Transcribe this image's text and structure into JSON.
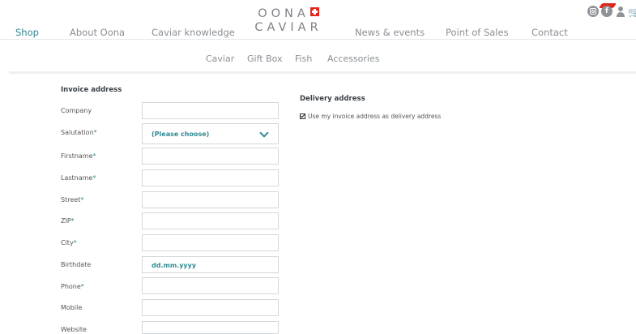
{
  "brand": {
    "logo_line1": "OONA",
    "logo_line2": "CAVIAR"
  },
  "nav": {
    "left": [
      {
        "label": "Shop",
        "active": true
      },
      {
        "label": "About Oona"
      },
      {
        "label": "Caviar knowledge"
      }
    ],
    "right": [
      {
        "label": "News & events"
      },
      {
        "label": "Point of Sales"
      },
      {
        "label": "Contact"
      }
    ]
  },
  "header_icons": [
    "instagram-icon",
    "facebook-icon",
    "user-icon",
    "cart-icon"
  ],
  "subnav": [
    {
      "label": "Caviar"
    },
    {
      "label": "Gift Box"
    },
    {
      "label": "Fish"
    },
    {
      "label": "Accessories"
    }
  ],
  "invoice": {
    "title": "Invoice address",
    "required_marker": "*",
    "fields": [
      {
        "label": "Company",
        "required": false,
        "value": ""
      },
      {
        "label": "Salutation",
        "required": true,
        "value": "(Please choose)",
        "type": "select"
      },
      {
        "label": "Firstname",
        "required": true,
        "value": ""
      },
      {
        "label": "Lastname",
        "required": true,
        "value": ""
      },
      {
        "label": "Street",
        "required": true,
        "value": ""
      },
      {
        "label": "ZIP",
        "required": true,
        "value": ""
      },
      {
        "label": "City",
        "required": true,
        "value": ""
      },
      {
        "label": "Birthdate",
        "required": false,
        "value": "",
        "placeholder": "dd.mm.yyyy"
      },
      {
        "label": "Phone",
        "required": true,
        "value": ""
      },
      {
        "label": "Mobile",
        "required": false,
        "value": ""
      },
      {
        "label": "Website",
        "required": false,
        "value": ""
      }
    ]
  },
  "delivery": {
    "title": "Delivery address",
    "same_as_invoice_label": "Use my invoice address as delivery address",
    "same_as_invoice_checked": true
  },
  "colors": {
    "accent": "#2f8a93",
    "brand_red": "#e1251b",
    "nav_text": "#8a8f94"
  }
}
